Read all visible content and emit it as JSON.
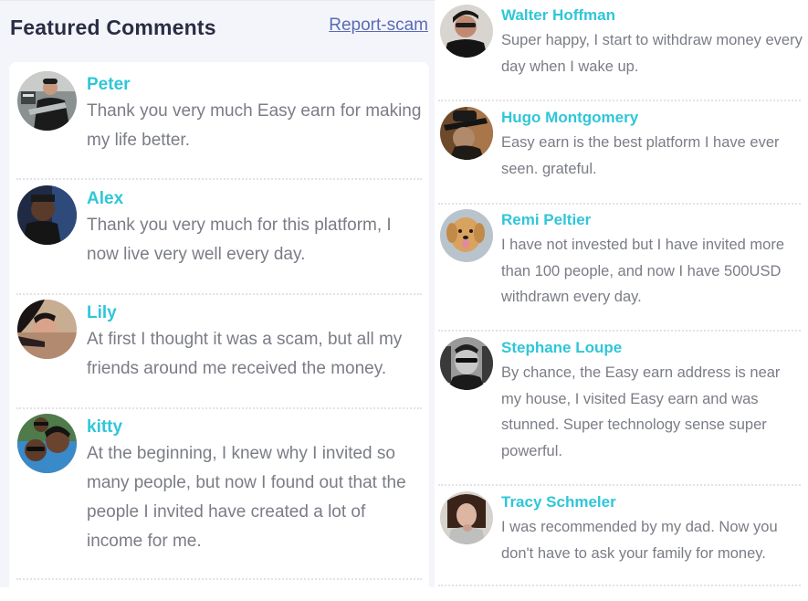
{
  "header": {
    "title": "Featured Comments",
    "report_link": "Report-scam"
  },
  "colors": {
    "name_accent": "#2fc6d8",
    "comment_text": "#7a7d85",
    "title": "#2a2d45",
    "link": "#5a6bb5"
  },
  "left_comments": [
    {
      "name": "Peter",
      "text": "Thank you very much Easy earn for making my life better.",
      "avatar_icon": "avatar-man-holding-fish"
    },
    {
      "name": "Alex",
      "text": "Thank you very much for this platform, I now live very well every day.",
      "avatar_icon": "avatar-man-selfie"
    },
    {
      "name": "Lily",
      "text": "At first I thought it was a scam, but all my friends around me received the money.",
      "avatar_icon": "avatar-woman-lying"
    },
    {
      "name": "kitty",
      "text": "At the beginning, I knew why I invited so many people, but now I found out that the people I invited have created a lot of income for me.",
      "avatar_icon": "avatar-group-selfie"
    }
  ],
  "right_comments": [
    {
      "name": "Walter Hoffman",
      "text": "Super happy, I start to withdraw money every day when I wake up.",
      "avatar_icon": "avatar-woman-glasses"
    },
    {
      "name": "Hugo Montgomery",
      "text": "Easy earn is the best platform I have ever seen. grateful.",
      "avatar_icon": "avatar-man-hat"
    },
    {
      "name": "Remi Peltier",
      "text": "I have not invested but I have invited more than 100 people, and now I have 500USD withdrawn every day.",
      "avatar_icon": "avatar-dog"
    },
    {
      "name": "Stephane Loupe",
      "text": "By chance, the Easy earn address is near my house, I visited Easy earn and was stunned. Super technology sense super powerful.",
      "avatar_icon": "avatar-man-sunglasses"
    },
    {
      "name": "Tracy Schmeler",
      "text": "I was recommended by my dad. Now you don't have to ask your family for money.",
      "avatar_icon": "avatar-woman-portrait"
    }
  ]
}
